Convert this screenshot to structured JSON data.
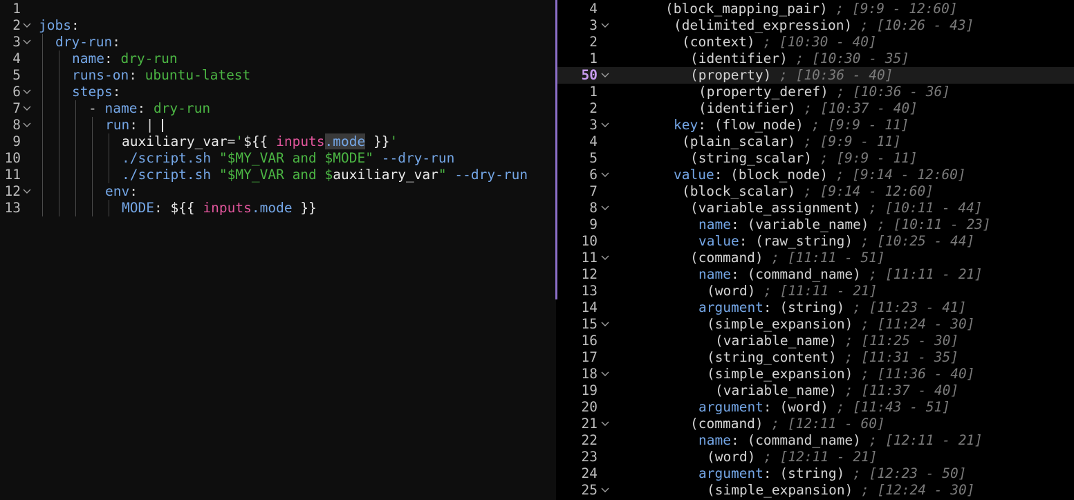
{
  "editor": {
    "current_line": "50",
    "lines": [
      {
        "n": "1",
        "fold": false,
        "indent": 0,
        "tokens": []
      },
      {
        "n": "2",
        "fold": true,
        "indent": 0,
        "tokens": [
          [
            "k",
            "jobs"
          ],
          [
            "p",
            ":"
          ]
        ]
      },
      {
        "n": "3",
        "fold": true,
        "indent": 1,
        "tokens": [
          [
            "k",
            "dry-run"
          ],
          [
            "p",
            ":"
          ]
        ]
      },
      {
        "n": "4",
        "fold": false,
        "indent": 2,
        "tokens": [
          [
            "k",
            "name"
          ],
          [
            "p",
            ": "
          ],
          [
            "s",
            "dry-run"
          ]
        ]
      },
      {
        "n": "5",
        "fold": false,
        "indent": 2,
        "tokens": [
          [
            "k",
            "runs-on"
          ],
          [
            "p",
            ": "
          ],
          [
            "s",
            "ubuntu-latest"
          ]
        ]
      },
      {
        "n": "6",
        "fold": true,
        "indent": 2,
        "tokens": [
          [
            "k",
            "steps"
          ],
          [
            "p",
            ":"
          ]
        ]
      },
      {
        "n": "7",
        "fold": true,
        "indent": 3,
        "tokens": [
          [
            "p",
            "- "
          ],
          [
            "k",
            "name"
          ],
          [
            "p",
            ": "
          ],
          [
            "s",
            "dry-run"
          ]
        ]
      },
      {
        "n": "8",
        "fold": true,
        "indent": 4,
        "tokens": [
          [
            "k",
            "run"
          ],
          [
            "p",
            ": |"
          ]
        ]
      },
      {
        "n": "9",
        "fold": false,
        "indent": 5,
        "tokens": [
          [
            "w",
            "auxiliary_var"
          ],
          [
            "p",
            "="
          ],
          [
            "s",
            "'"
          ],
          [
            "w",
            "${{ "
          ],
          [
            "e",
            "inputs"
          ],
          [
            "sel",
            ".mode"
          ],
          [
            "w",
            " }}"
          ],
          [
            "s",
            "'"
          ]
        ]
      },
      {
        "n": "10",
        "fold": false,
        "indent": 5,
        "tokens": [
          [
            "k",
            "./script.sh "
          ],
          [
            "s",
            "\""
          ],
          [
            "s",
            "$MY_VAR"
          ],
          [
            "s",
            " and "
          ],
          [
            "s",
            "$MODE"
          ],
          [
            "s",
            "\""
          ],
          [
            "k",
            " --dry-run"
          ]
        ]
      },
      {
        "n": "11",
        "fold": false,
        "indent": 5,
        "tokens": [
          [
            "k",
            "./script.sh "
          ],
          [
            "s",
            "\""
          ],
          [
            "s",
            "$MY_VAR"
          ],
          [
            "s",
            " and "
          ],
          [
            "s",
            "$"
          ],
          [
            "w",
            "auxiliary_var"
          ],
          [
            "s",
            "\""
          ],
          [
            "k",
            " --dry-run"
          ]
        ]
      },
      {
        "n": "12",
        "fold": true,
        "indent": 4,
        "tokens": [
          [
            "k",
            "env"
          ],
          [
            "p",
            ":"
          ]
        ]
      },
      {
        "n": "13",
        "fold": false,
        "indent": 5,
        "tokens": [
          [
            "k",
            "MODE"
          ],
          [
            "p",
            ": "
          ],
          [
            "w",
            "${{ "
          ],
          [
            "e",
            "inputs"
          ],
          [
            "k",
            ".mode"
          ],
          [
            "w",
            " }}"
          ]
        ]
      }
    ]
  },
  "tree": {
    "lines": [
      {
        "n": "4",
        "fold": false,
        "indent": 6,
        "tokens": [
          [
            "p",
            "(block_mapping_pair)"
          ],
          [
            "cm",
            " ; [9:9 - 12:60]"
          ]
        ]
      },
      {
        "n": "3",
        "fold": true,
        "indent": 7,
        "tokens": [
          [
            "p",
            "(delimited_expression)"
          ],
          [
            "cm",
            " ; [10:26 - 43]"
          ]
        ]
      },
      {
        "n": "2",
        "fold": false,
        "indent": 8,
        "tokens": [
          [
            "p",
            "(context)"
          ],
          [
            "cm",
            " ; [10:30 - 40]"
          ]
        ]
      },
      {
        "n": "1",
        "fold": false,
        "indent": 9,
        "tokens": [
          [
            "p",
            "(identifier)"
          ],
          [
            "cm",
            " ; [10:30 - 35]"
          ]
        ]
      },
      {
        "n": "50",
        "fold": true,
        "indent": 9,
        "current": true,
        "tokens": [
          [
            "p",
            "(property)"
          ],
          [
            "cm",
            " ; [10:36 - 40]"
          ]
        ]
      },
      {
        "n": "1",
        "fold": false,
        "indent": 10,
        "tokens": [
          [
            "p",
            "(property_deref)"
          ],
          [
            "cm",
            " ; [10:36 - 36]"
          ]
        ]
      },
      {
        "n": "2",
        "fold": false,
        "indent": 10,
        "tokens": [
          [
            "p",
            "(identifier)"
          ],
          [
            "cm",
            " ; [10:37 - 40]"
          ]
        ]
      },
      {
        "n": "3",
        "fold": true,
        "indent": 7,
        "tokens": [
          [
            "k",
            "key"
          ],
          [
            "p",
            ": (flow_node)"
          ],
          [
            "cm",
            " ; [9:9 - 11]"
          ]
        ]
      },
      {
        "n": "4",
        "fold": false,
        "indent": 8,
        "tokens": [
          [
            "p",
            "(plain_scalar)"
          ],
          [
            "cm",
            " ; [9:9 - 11]"
          ]
        ]
      },
      {
        "n": "5",
        "fold": false,
        "indent": 9,
        "tokens": [
          [
            "p",
            "(string_scalar)"
          ],
          [
            "cm",
            " ; [9:9 - 11]"
          ]
        ]
      },
      {
        "n": "6",
        "fold": true,
        "indent": 7,
        "tokens": [
          [
            "k",
            "value"
          ],
          [
            "p",
            ": (block_node)"
          ],
          [
            "cm",
            " ; [9:14 - 12:60]"
          ]
        ]
      },
      {
        "n": "7",
        "fold": false,
        "indent": 8,
        "tokens": [
          [
            "p",
            "(block_scalar)"
          ],
          [
            "cm",
            " ; [9:14 - 12:60]"
          ]
        ]
      },
      {
        "n": "8",
        "fold": true,
        "indent": 9,
        "tokens": [
          [
            "p",
            "(variable_assignment)"
          ],
          [
            "cm",
            " ; [10:11 - 44]"
          ]
        ]
      },
      {
        "n": "9",
        "fold": false,
        "indent": 10,
        "tokens": [
          [
            "k",
            "name"
          ],
          [
            "p",
            ": (variable_name)"
          ],
          [
            "cm",
            " ; [10:11 - 23]"
          ]
        ]
      },
      {
        "n": "10",
        "fold": false,
        "indent": 10,
        "tokens": [
          [
            "k",
            "value"
          ],
          [
            "p",
            ": (raw_string)"
          ],
          [
            "cm",
            " ; [10:25 - 44]"
          ]
        ]
      },
      {
        "n": "11",
        "fold": true,
        "indent": 9,
        "tokens": [
          [
            "p",
            "(command)"
          ],
          [
            "cm",
            " ; [11:11 - 51]"
          ]
        ]
      },
      {
        "n": "12",
        "fold": false,
        "indent": 10,
        "tokens": [
          [
            "k",
            "name"
          ],
          [
            "p",
            ": (command_name)"
          ],
          [
            "cm",
            " ; [11:11 - 21]"
          ]
        ]
      },
      {
        "n": "13",
        "fold": false,
        "indent": 11,
        "tokens": [
          [
            "p",
            "(word)"
          ],
          [
            "cm",
            " ; [11:11 - 21]"
          ]
        ]
      },
      {
        "n": "14",
        "fold": false,
        "indent": 10,
        "tokens": [
          [
            "k",
            "argument"
          ],
          [
            "p",
            ": (string)"
          ],
          [
            "cm",
            " ; [11:23 - 41]"
          ]
        ]
      },
      {
        "n": "15",
        "fold": true,
        "indent": 11,
        "tokens": [
          [
            "p",
            "(simple_expansion)"
          ],
          [
            "cm",
            " ; [11:24 - 30]"
          ]
        ]
      },
      {
        "n": "16",
        "fold": false,
        "indent": 12,
        "tokens": [
          [
            "p",
            "(variable_name)"
          ],
          [
            "cm",
            " ; [11:25 - 30]"
          ]
        ]
      },
      {
        "n": "17",
        "fold": false,
        "indent": 11,
        "tokens": [
          [
            "p",
            "(string_content)"
          ],
          [
            "cm",
            " ; [11:31 - 35]"
          ]
        ]
      },
      {
        "n": "18",
        "fold": true,
        "indent": 11,
        "tokens": [
          [
            "p",
            "(simple_expansion)"
          ],
          [
            "cm",
            " ; [11:36 - 40]"
          ]
        ]
      },
      {
        "n": "19",
        "fold": false,
        "indent": 12,
        "tokens": [
          [
            "p",
            "(variable_name)"
          ],
          [
            "cm",
            " ; [11:37 - 40]"
          ]
        ]
      },
      {
        "n": "20",
        "fold": false,
        "indent": 10,
        "tokens": [
          [
            "k",
            "argument"
          ],
          [
            "p",
            ": (word)"
          ],
          [
            "cm",
            " ; [11:43 - 51]"
          ]
        ]
      },
      {
        "n": "21",
        "fold": true,
        "indent": 9,
        "tokens": [
          [
            "p",
            "(command)"
          ],
          [
            "cm",
            " ; [12:11 - 60]"
          ]
        ]
      },
      {
        "n": "22",
        "fold": false,
        "indent": 10,
        "tokens": [
          [
            "k",
            "name"
          ],
          [
            "p",
            ": (command_name)"
          ],
          [
            "cm",
            " ; [12:11 - 21]"
          ]
        ]
      },
      {
        "n": "23",
        "fold": false,
        "indent": 11,
        "tokens": [
          [
            "p",
            "(word)"
          ],
          [
            "cm",
            " ; [12:11 - 21]"
          ]
        ]
      },
      {
        "n": "24",
        "fold": false,
        "indent": 10,
        "tokens": [
          [
            "k",
            "argument"
          ],
          [
            "p",
            ": (string)"
          ],
          [
            "cm",
            " ; [12:23 - 50]"
          ]
        ]
      },
      {
        "n": "25",
        "fold": true,
        "indent": 11,
        "tokens": [
          [
            "p",
            "(simple_expansion)"
          ],
          [
            "cm",
            " ; [12:24 - 30]"
          ]
        ]
      }
    ]
  }
}
